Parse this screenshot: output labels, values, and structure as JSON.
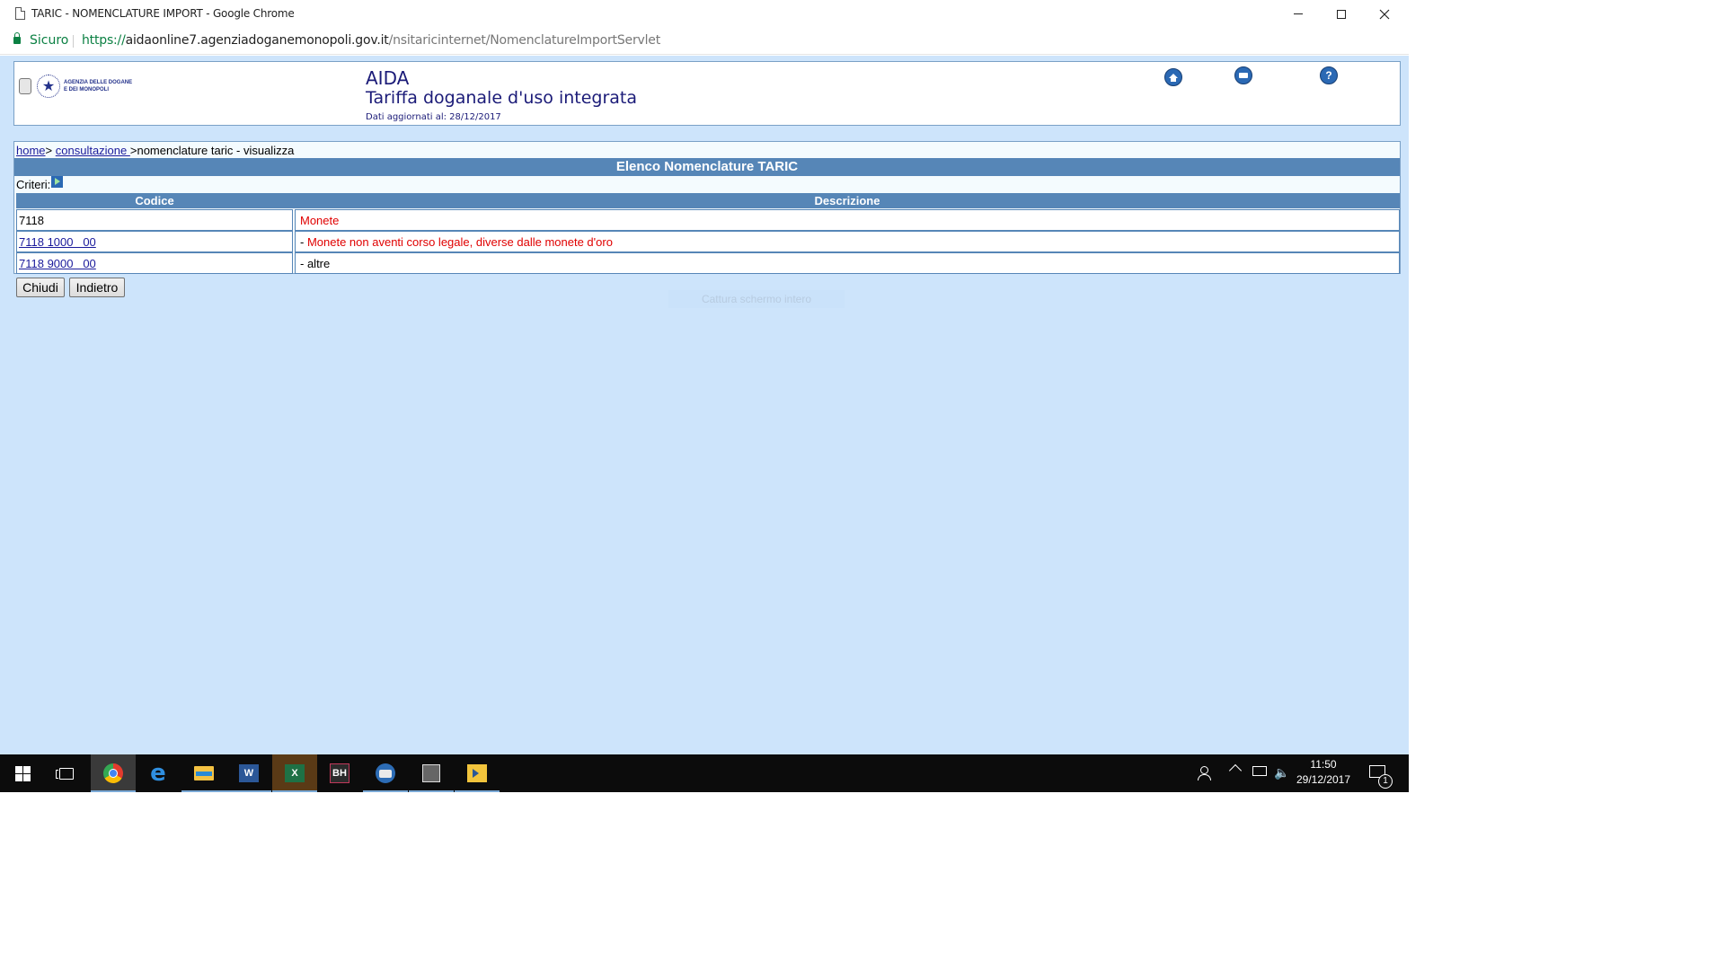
{
  "window": {
    "title": "TARIC - NOMENCLATURE IMPORT - Google Chrome",
    "icons": [
      "page-icon",
      "minimize-icon",
      "maximize-icon",
      "close-icon"
    ]
  },
  "addressbar": {
    "secure_label": "Sicuro",
    "url_scheme": "https://",
    "url_host": "aidaonline7.agenziadoganemonopoli.gov.it",
    "url_path": "/nsitaricinternet/NomenclatureImportServlet"
  },
  "header": {
    "logo_text_line1": "AGENZIA DELLE DOGANE",
    "logo_text_line2": "E DEI MONOPOLI",
    "app_title": "AIDA",
    "app_subtitle": "Tariffa doganale d'uso integrata",
    "date_label": "Dati aggiornati al: 28/12/2017",
    "icons": [
      "home-icon",
      "print-icon",
      "help-icon"
    ],
    "help_glyph": "?"
  },
  "breadcrumb": {
    "home": "home",
    "sep1": ">",
    "consultazione": "consultazione ",
    "current": ">nomenclature taric - visualizza"
  },
  "section_title": "Elenco Nomenclature TARIC",
  "criteri_label": "Criteri:",
  "table": {
    "headers": {
      "code": "Codice",
      "description": "Descrizione"
    },
    "rows": [
      {
        "code": "7118",
        "dash": "",
        "description": "Monete",
        "desc_color": "#e00000",
        "code_link": false
      },
      {
        "code": "7118 1000   00",
        "dash": "- ",
        "description": "Monete non aventi corso legale, diverse dalle monete d'oro",
        "desc_color": "#e00000",
        "code_link": true
      },
      {
        "code": "7118 9000   00",
        "dash": "- ",
        "description": "altre",
        "desc_color": "#000000",
        "code_link": true
      }
    ]
  },
  "buttons": {
    "close": "Chiudi",
    "back": "Indietro"
  },
  "overlay_text": "Cattura schermo intero",
  "taskbar": {
    "apps": [
      "start-icon",
      "task-view-icon",
      "chrome-icon",
      "edge-icon",
      "file-explorer-icon",
      "word-icon",
      "excel-icon",
      "bh-icon",
      "thunderbird-icon",
      "app-icon",
      "powershell-icon"
    ],
    "word_letter": "W",
    "excel_letter": "X",
    "bh_letters": "BH",
    "edge_letter": "e",
    "volume_glyph": "🔈",
    "time": "11:50",
    "date": "29/12/2017",
    "notification_count": "1"
  },
  "colors": {
    "page_bg": "#cde4fb",
    "header_bar": "#5686b7",
    "link": "#1a1a9b",
    "title_text": "#1b1b78",
    "secure_green": "#0b8043"
  }
}
